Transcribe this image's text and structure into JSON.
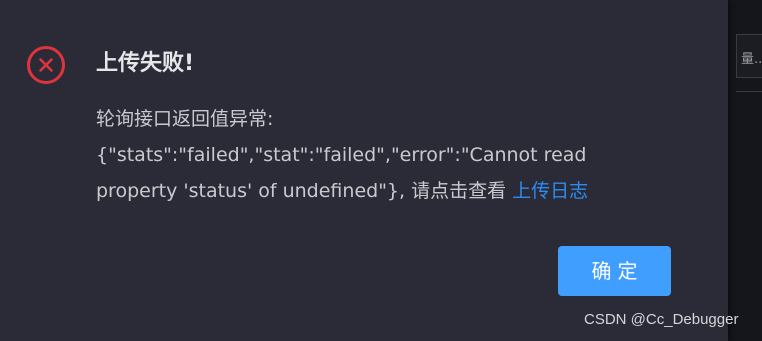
{
  "dialog": {
    "title": "上传失败!",
    "message_line1": "轮询接口返回值异常:",
    "message_line2": "{\"stats\":\"failed\",\"stat\":\"failed\",\"error\":\"Cannot read",
    "message_line3": "property 'status' of undefined\"}, 请点击查看 ",
    "log_link_label": "上传日志",
    "ok_button_label": "确定",
    "icon": "error-circle-x-icon"
  },
  "background": {
    "partial_text": "量..."
  },
  "watermark": "CSDN @Cc_Debugger",
  "colors": {
    "dialog_bg": "#2a2b36",
    "error_red": "#e0343c",
    "link_blue": "#2d8cf0",
    "button_blue": "#409eff"
  }
}
